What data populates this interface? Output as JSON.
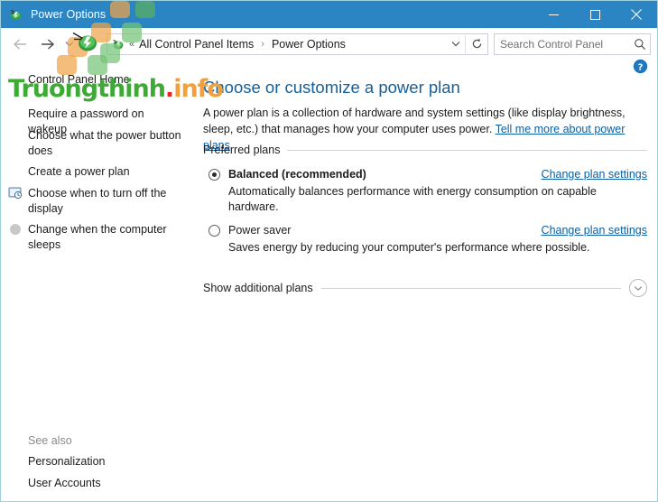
{
  "window": {
    "title": "Power Options",
    "titlebar_color": "#2b85c3",
    "border_color": "#9fd0de",
    "controls": {
      "minimize": "minimize-button",
      "maximize": "maximize-button",
      "close": "close-button"
    }
  },
  "navbar": {
    "back": "Back",
    "forward": "Forward",
    "recent": "Recent locations",
    "up": "Up",
    "breadcrumb": {
      "overflow": "«",
      "items": [
        "All Control Panel Items",
        "Power Options"
      ],
      "separator": "›"
    },
    "dropdown": "Previous locations",
    "refresh": "Refresh",
    "search": {
      "placeholder": "Search Control Panel",
      "value": ""
    }
  },
  "sidebar": {
    "home_label": "Control Panel Home",
    "items": [
      {
        "label": "Require a password on wakeup",
        "icon": ""
      },
      {
        "label": "Choose what the power button does",
        "icon": ""
      },
      {
        "label": "Create a power plan",
        "icon": ""
      },
      {
        "label": "Choose when to turn off the display",
        "icon": "display-clock-icon"
      },
      {
        "label": "Change when the computer sleeps",
        "icon": "moon-sleep-icon"
      }
    ],
    "see_also_label": "See also",
    "see_also_items": [
      "Personalization",
      "User Accounts"
    ]
  },
  "main": {
    "page_title": "Choose or customize a power plan",
    "intro_text": "A power plan is a collection of hardware and system settings (like display brightness, sleep, etc.) that manages how your computer uses power. ",
    "intro_link": "Tell me more about power plans",
    "group_label": "Preferred plans",
    "plans": [
      {
        "name": "Balanced (recommended)",
        "description": "Automatically balances performance with energy consumption on capable hardware.",
        "link": "Change plan settings",
        "selected": true,
        "link_hover": true
      },
      {
        "name": "Power saver",
        "description": "Saves energy by reducing your computer's performance where possible.",
        "link": "Change plan settings",
        "selected": false,
        "link_hover": false
      }
    ],
    "additional_label": "Show additional plans",
    "additional_icon": "chevron-down-icon",
    "help_icon": "help-question-icon",
    "link_color": "#0b5fa5",
    "title_color": "#15609c"
  },
  "watermark": {
    "text_part1": "Truongthinh",
    "text_dot": ".",
    "text_part2": "info",
    "color_green": "#3daa35",
    "color_red": "#e02826",
    "color_orange": "#f2a03c",
    "square_orange": "#f0a44a",
    "square_green": "#74c476"
  }
}
